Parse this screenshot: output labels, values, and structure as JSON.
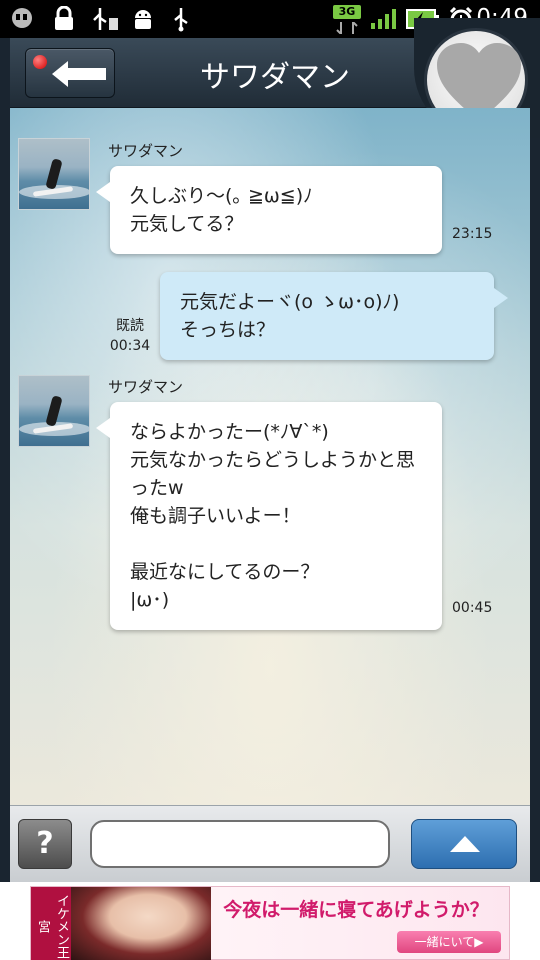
{
  "status_bar": {
    "network": "3G",
    "time": "0:49",
    "icons": [
      "hangouts-icon",
      "lock-icon",
      "usb-debug-icon",
      "android-icon",
      "usb-icon",
      "signal-icon",
      "battery-charging-icon",
      "alarm-icon"
    ]
  },
  "header": {
    "title": "サワダマン"
  },
  "messages": [
    {
      "direction": "incoming",
      "sender": "サワダマン",
      "text": "久しぶり〜(｡ ≧ω≦)ﾉ\n元気してる？",
      "time": "23:15"
    },
    {
      "direction": "outgoing",
      "read_label": "既読",
      "text": "元気だよーヾ(o ゝω･o)ﾉ)\nそっちは？",
      "time": "00:34"
    },
    {
      "direction": "incoming",
      "sender": "サワダマン",
      "text": "ならよかったー(*ﾉ∀`*)\n元気なかったらどうしようかと思\nったw\n俺も調子いいよー！\n\n最近なにしてるのー？\n|ω･)",
      "time": "00:45"
    }
  ],
  "input_bar": {
    "help_label": "?",
    "placeholder": ""
  },
  "ad": {
    "brand": "イケメン王宮",
    "headline": "今夜は一緒に寝てあげようか？",
    "button": "一緒にいて▶"
  },
  "colors": {
    "header": "#2a3845",
    "outgoing_bubble": "#cfeaf8",
    "incoming_bubble": "#ffffff",
    "send_button": "#3a7cc0",
    "battery": "#7ac943"
  }
}
